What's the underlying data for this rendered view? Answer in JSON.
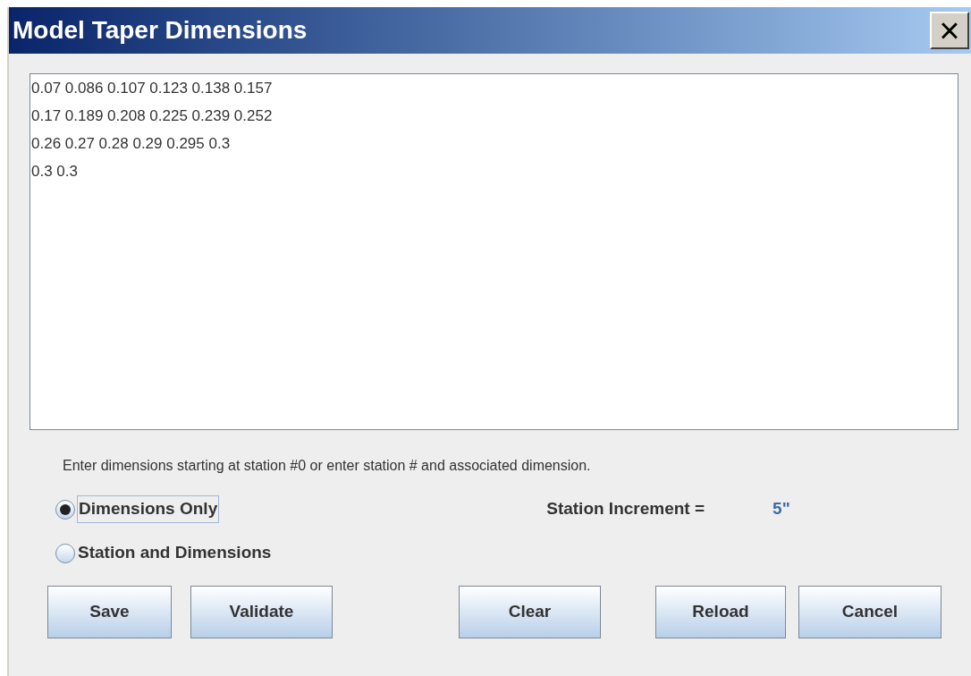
{
  "window": {
    "title": "Model Taper Dimensions",
    "close": "×"
  },
  "text_area": {
    "value": [
      "0.07 0.086 0.107 0.123 0.138 0.157",
      "0.17 0.189 0.208 0.225 0.239 0.252",
      "0.26 0.27 0.28 0.29 0.295 0.3",
      "0.3 0.3"
    ]
  },
  "instruction": "Enter dimensions starting at station #0 or enter station # and associated dimension.",
  "modes": [
    {
      "label": "Dimensions Only",
      "selected": true
    },
    {
      "label": "Station and Dimensions",
      "selected": false
    }
  ],
  "station_increment": {
    "label": "Station Increment =",
    "value": "5\""
  },
  "buttons": [
    "Save",
    "Validate",
    "Clear",
    "Reload",
    "Cancel"
  ]
}
